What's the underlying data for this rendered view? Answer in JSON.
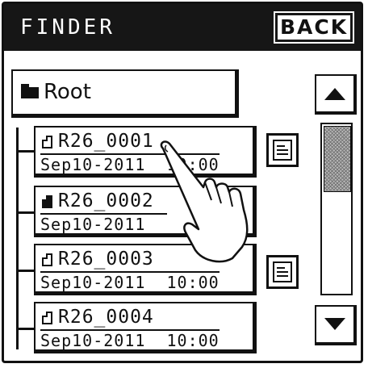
{
  "header": {
    "title": "FINDER",
    "back_label": "BACK"
  },
  "folder": {
    "root_label": "Root"
  },
  "files": [
    {
      "name": "R26_0001",
      "date": "Sep10-2011",
      "time": "10:00",
      "icon": "file-icon"
    },
    {
      "name": "R26_0002",
      "date": "Sep10-2011",
      "time": "",
      "icon": "locked-file-icon"
    },
    {
      "name": "R26_0003",
      "date": "Sep10-2011",
      "time": "10:00",
      "icon": "file-icon"
    },
    {
      "name": "R26_0004",
      "date": "Sep10-2011",
      "time": "10:00",
      "icon": "file-icon"
    }
  ],
  "colors": {
    "title_bar": "#161616",
    "ink": "#111111",
    "background": "#ffffff"
  },
  "icons": {
    "detail": "document-lines-icon",
    "scroll_up": "triangle-up-icon",
    "scroll_down": "triangle-down-icon",
    "folder": "folder-icon",
    "pointer": "pointing-hand-icon"
  }
}
